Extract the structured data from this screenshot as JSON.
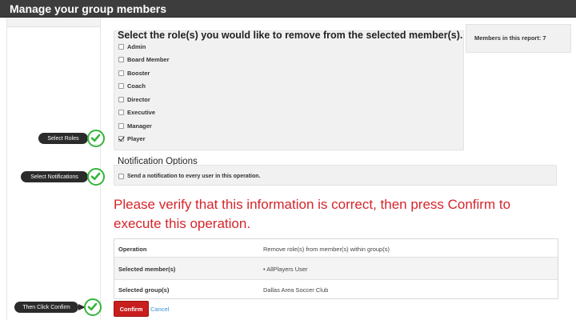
{
  "title": "Manage your group members",
  "roles": {
    "heading": "Select the role(s) you would like to remove from the selected member(s).",
    "items": [
      {
        "label": "Admin",
        "checked": false
      },
      {
        "label": "Board Member",
        "checked": false
      },
      {
        "label": "Booster",
        "checked": false
      },
      {
        "label": "Coach",
        "checked": false
      },
      {
        "label": "Director",
        "checked": false
      },
      {
        "label": "Executive",
        "checked": false
      },
      {
        "label": "Manager",
        "checked": false
      },
      {
        "label": "Player",
        "checked": true
      }
    ]
  },
  "members_count_text": "Members in this report: 7",
  "notification": {
    "heading": "Notification Options",
    "option_label": "Send a notification to every user in this operation.",
    "checked": false
  },
  "verify_message": "Please verify that this information is correct, then press Confirm to execute this operation.",
  "summary": [
    {
      "key": "Operation",
      "value": "Remove role(s) from member(s) within group(s)"
    },
    {
      "key": "Selected member(s)",
      "value": "• AllPlayers User"
    },
    {
      "key": "Selected group(s)",
      "value": "Dallas Area Soccer Club"
    }
  ],
  "buttons": {
    "confirm": "Confirm",
    "cancel": "Cancel"
  },
  "callouts": {
    "select_roles": "Select Roles",
    "select_notifications": "Select Notifications",
    "then_click_confirm": "Then Click Confirm"
  },
  "colors": {
    "accent_red": "#d6252b",
    "confirm_red": "#c81e1e",
    "link_blue": "#3a8fd6",
    "callout_green": "#35b43a"
  },
  "icons": {
    "callout": "check-circle-icon"
  }
}
